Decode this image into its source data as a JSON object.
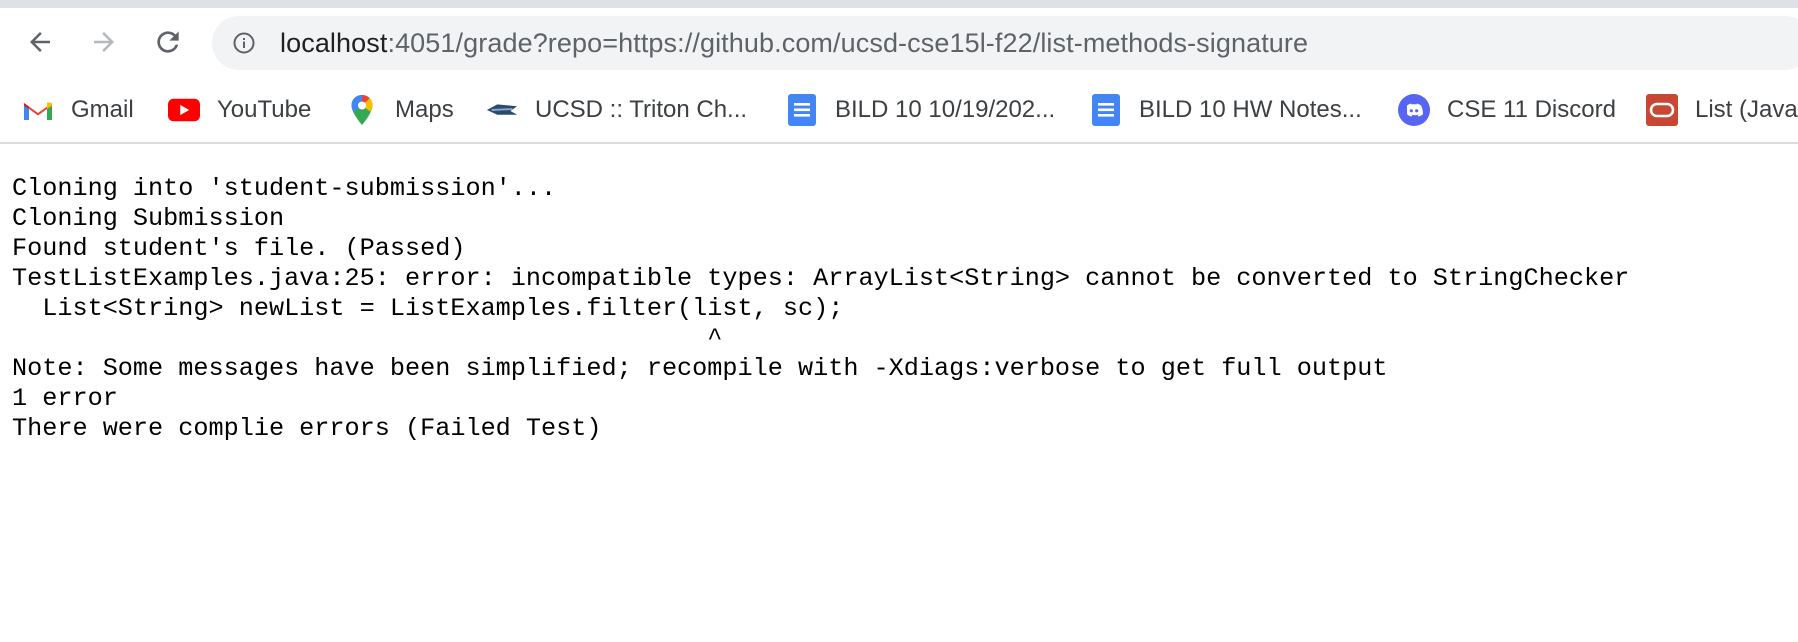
{
  "browser": {
    "back_icon": "arrow-left-icon",
    "forward_icon": "arrow-right-icon",
    "reload_icon": "reload-icon",
    "info_icon": "info-circle-icon",
    "url_host": "localhost",
    "url_rest": ":4051/grade?repo=https://github.com/ucsd-cse15l-f22/list-methods-signature"
  },
  "bookmarks": [
    {
      "label": "Gmail",
      "icon": "gmail-icon"
    },
    {
      "label": "YouTube",
      "icon": "youtube-icon"
    },
    {
      "label": "Maps",
      "icon": "maps-icon"
    },
    {
      "label": "UCSD :: Triton Ch...",
      "icon": "triton-icon"
    },
    {
      "label": "BILD 10 10/19/202...",
      "icon": "google-docs-icon"
    },
    {
      "label": "BILD 10 HW Notes...",
      "icon": "google-docs-icon"
    },
    {
      "label": "CSE 11 Discord",
      "icon": "discord-icon"
    },
    {
      "label": "List (Java",
      "icon": "oracle-icon"
    }
  ],
  "output": {
    "lines": [
      "Cloning into 'student-submission'...",
      "Cloning Submission",
      "Found student's file. (Passed)",
      "TestListExamples.java:25: error: incompatible types: ArrayList<String> cannot be converted to StringChecker",
      "  List<String> newList = ListExamples.filter(list, sc);",
      "                                              ^",
      "Note: Some messages have been simplified; recompile with -Xdiags:verbose to get full output",
      "1 error",
      "There were complie errors (Failed Test)"
    ]
  }
}
